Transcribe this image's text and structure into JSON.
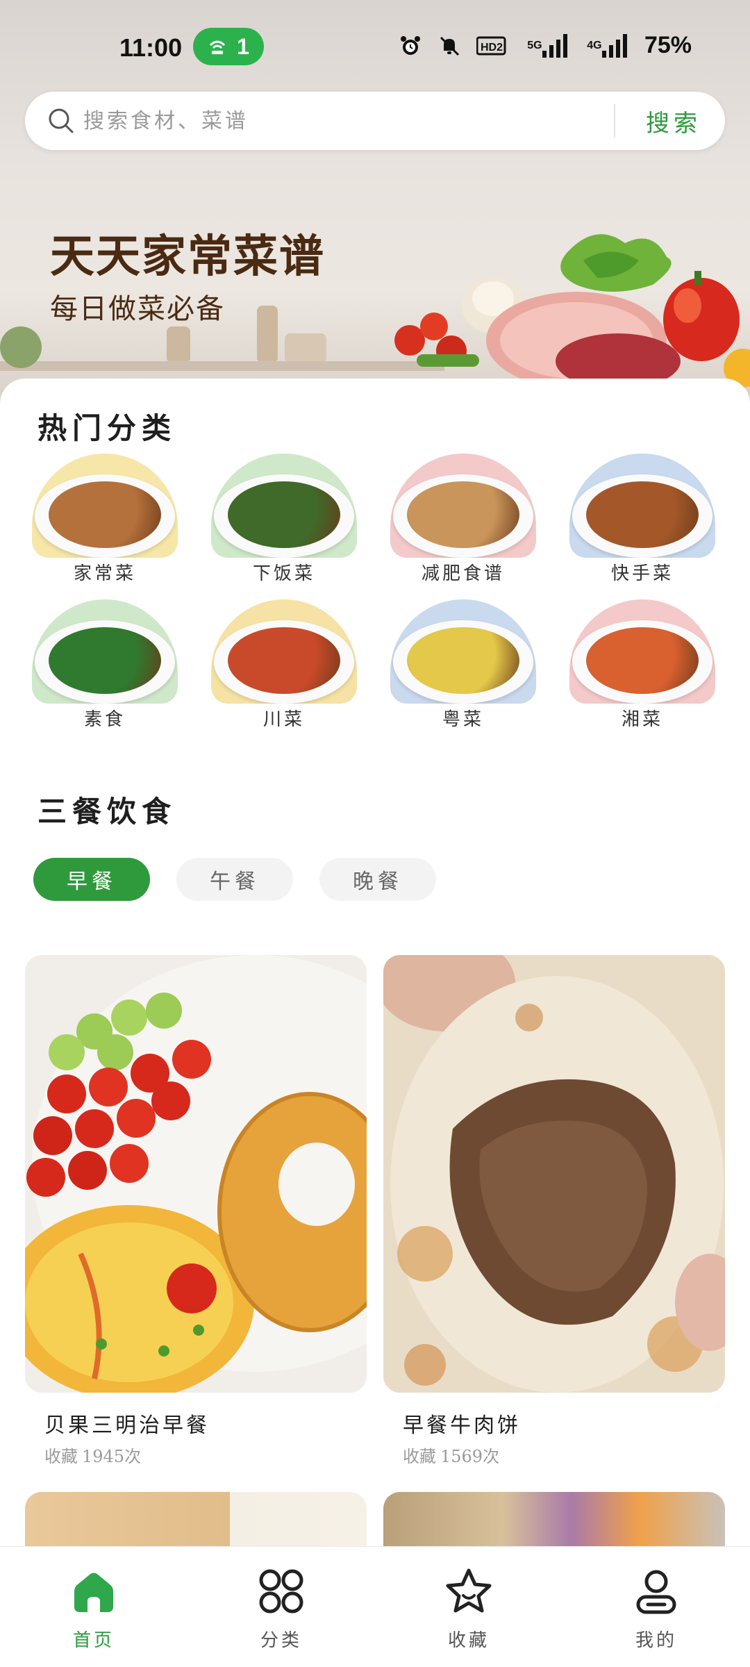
{
  "status_bar": {
    "time": "11:00",
    "hotspot_count": "1",
    "battery": "75%",
    "network_tags": [
      "5G",
      "4G"
    ],
    "hd_tag": "HD2",
    "icons": [
      "alarm-icon",
      "mute-icon",
      "hd-icon",
      "signal-5g-icon",
      "signal-4g-icon"
    ]
  },
  "search": {
    "placeholder": "搜索食材、菜谱",
    "button_label": "搜索"
  },
  "banner": {
    "title": "天天家常菜谱",
    "subtitle": "每日做菜必备"
  },
  "hot_categories": {
    "title": "热门分类",
    "items": [
      {
        "label": "家常菜",
        "arch_color": "#f6e6a8",
        "food_color": "#b5713c"
      },
      {
        "label": "下饭菜",
        "arch_color": "#cfe8c9",
        "food_color": "#3f6a2a"
      },
      {
        "label": "减肥食谱",
        "arch_color": "#f4c9c9",
        "food_color": "#c9955a"
      },
      {
        "label": "快手菜",
        "arch_color": "#c9d9ee",
        "food_color": "#a4582a"
      },
      {
        "label": "素食",
        "arch_color": "#cfe8c9",
        "food_color": "#2f7a2e"
      },
      {
        "label": "川菜",
        "arch_color": "#f6e2a4",
        "food_color": "#c94a2a"
      },
      {
        "label": "粤菜",
        "arch_color": "#c9d9ee",
        "food_color": "#e3c84a"
      },
      {
        "label": "湘菜",
        "arch_color": "#f4c9c9",
        "food_color": "#d9602f"
      }
    ]
  },
  "meals": {
    "title": "三餐饮食",
    "tabs": [
      {
        "label": "早餐",
        "active": true
      },
      {
        "label": "午餐",
        "active": false
      },
      {
        "label": "晚餐",
        "active": false
      }
    ]
  },
  "recipes": [
    {
      "name": "贝果三明治早餐",
      "fav_prefix": "收藏",
      "fav_count": "1945次"
    },
    {
      "name": "早餐牛肉饼",
      "fav_prefix": "收藏",
      "fav_count": "1569次"
    }
  ],
  "bottom_nav": [
    {
      "label": "首页",
      "icon": "home-icon",
      "active": true
    },
    {
      "label": "分类",
      "icon": "category-icon",
      "active": false
    },
    {
      "label": "收藏",
      "icon": "star-icon",
      "active": false
    },
    {
      "label": "我的",
      "icon": "user-icon",
      "active": false
    }
  ],
  "colors": {
    "accent": "#2e9a3c",
    "hotspot": "#2bb24c",
    "banner_text": "#4a2a12"
  }
}
